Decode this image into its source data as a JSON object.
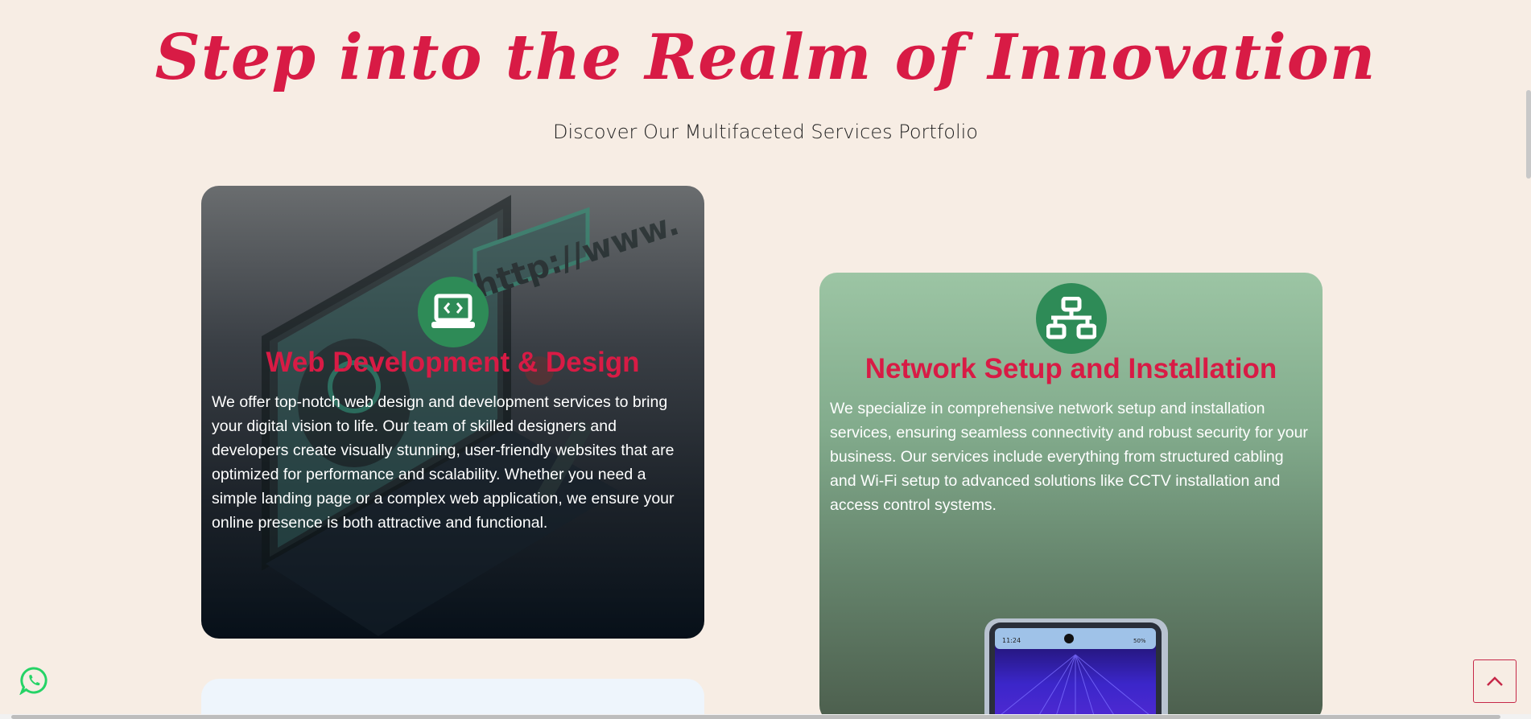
{
  "header": {
    "title": "Step into the Realm of Innovation",
    "subtitle": "Discover Our Multifaceted Services Portfolio"
  },
  "services": [
    {
      "title": "Web Development & Design",
      "icon": "laptop-code-icon",
      "description": "We offer top-notch web design and development services to bring your digital vision to life. Our team of skilled designers and developers create visually stunning, user-friendly websites that are optimized for performance and scalability. Whether you need a simple landing page or a complex web application, we ensure your online presence is both attractive and functional.",
      "illustration_text": "http://www."
    },
    {
      "title": "Network Setup and Installation",
      "icon": "network-icon",
      "description": "We specialize in comprehensive network setup and installation services, ensuring seamless connectivity and robust security for your business. Our services include everything from structured cabling and Wi-Fi setup to advanced solutions like CCTV installation and access control systems.",
      "phone_time": "11:24",
      "phone_battery": "50%"
    }
  ],
  "colors": {
    "accent": "#d81b45",
    "icon_badge": "#2e8b57",
    "background": "#f7ede4",
    "whatsapp": "#25d366"
  },
  "floating": {
    "whatsapp_icon": "whatsapp-icon",
    "scroll_top_icon": "chevron-up-icon"
  }
}
